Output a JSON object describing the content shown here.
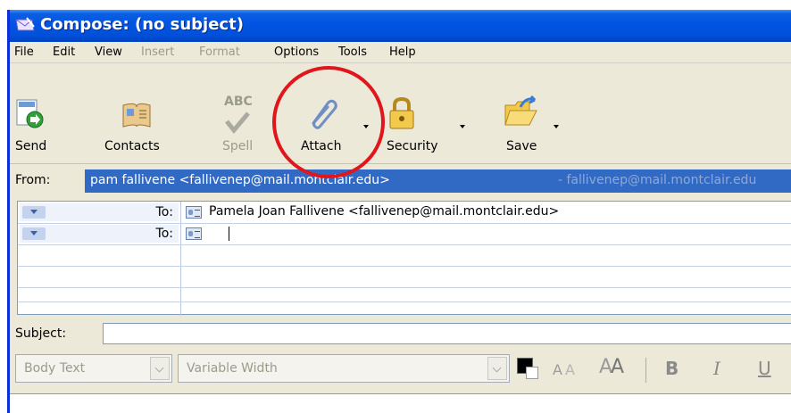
{
  "window": {
    "title": "Compose: (no subject)"
  },
  "menu": [
    {
      "label": "File",
      "enabled": true
    },
    {
      "label": "Edit",
      "enabled": true
    },
    {
      "label": "View",
      "enabled": true
    },
    {
      "label": "Insert",
      "enabled": false
    },
    {
      "label": "Format",
      "enabled": false
    },
    {
      "label": "Options",
      "enabled": true
    },
    {
      "label": "Tools",
      "enabled": true
    },
    {
      "label": "Help",
      "enabled": true
    }
  ],
  "toolbar": {
    "send": "Send",
    "contacts": "Contacts",
    "spell": "Spell",
    "spell_icon_text": "ABC",
    "attach": "Attach",
    "security": "Security",
    "save": "Save"
  },
  "from": {
    "label": "From:",
    "value": "pam fallivene <fallivenep@mail.montclair.edu>",
    "secondary": "- fallivenep@mail.montclair.edu"
  },
  "recipients": [
    {
      "type": "To:",
      "value": "Pamela Joan Fallivene <fallivenep@mail.montclair.edu>"
    },
    {
      "type": "To:",
      "value": ""
    }
  ],
  "subject": {
    "label": "Subject:",
    "value": ""
  },
  "format": {
    "paragraph": "Body Text",
    "font": "Variable Width",
    "smaller_glyph": "A",
    "larger_glyph": "A",
    "bold": "B",
    "italic": "I",
    "underline": "U"
  },
  "colors": {
    "titlebar": "#0054e3",
    "selection": "#316ac5",
    "highlight_circle": "#e0161c"
  }
}
